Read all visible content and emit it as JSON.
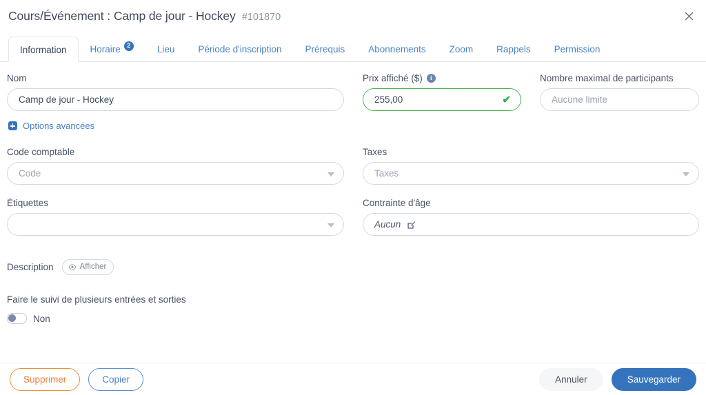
{
  "header": {
    "title": "Cours/Événement : Camp de jour - Hockey",
    "id": "#101870",
    "close_icon": "close-icon"
  },
  "tabs": [
    {
      "label": "Information",
      "active": true
    },
    {
      "label": "Horaire",
      "badge": "2"
    },
    {
      "label": "Lieu"
    },
    {
      "label": "Période d'inscription"
    },
    {
      "label": "Prérequis"
    },
    {
      "label": "Abonnements"
    },
    {
      "label": "Zoom"
    },
    {
      "label": "Rappels"
    },
    {
      "label": "Permission"
    }
  ],
  "form": {
    "nom": {
      "label": "Nom",
      "value": "Camp de jour - Hockey"
    },
    "prix": {
      "label": "Prix affiché ($)",
      "value": "255,00",
      "info_icon": "info-icon",
      "valid_icon": "check-icon"
    },
    "participants": {
      "label": "Nombre maximal de participants",
      "value": "",
      "placeholder": "Aucune limite"
    },
    "advanced": {
      "label": "Options avancées",
      "icon": "plus-square-icon"
    },
    "code_comptable": {
      "label": "Code comptable",
      "value": "",
      "placeholder": "Code"
    },
    "taxes": {
      "label": "Taxes",
      "value": "",
      "placeholder": "Taxes"
    },
    "etiquettes": {
      "label": "Étiquettes",
      "value": "",
      "placeholder": ""
    },
    "contrainte_age": {
      "label": "Contrainte d'âge",
      "value": "Aucun",
      "edit_icon": "edit-pencil-icon"
    },
    "description": {
      "label": "Description",
      "toggle_label": "Afficher",
      "eye_icon": "eye-icon"
    },
    "suivi": {
      "label": "Faire le suivi de plusieurs entrées et sorties",
      "state_label": "Non",
      "enabled": false
    }
  },
  "footer": {
    "delete_label": "Supprimer",
    "copy_label": "Copier",
    "cancel_label": "Annuler",
    "save_label": "Sauvegarder"
  },
  "colors": {
    "primary": "#3574bd",
    "link": "#4a82c4",
    "danger": "#e8813c",
    "valid": "#34a853",
    "text": "#3d4a5c",
    "border": "#d3d9e4"
  }
}
